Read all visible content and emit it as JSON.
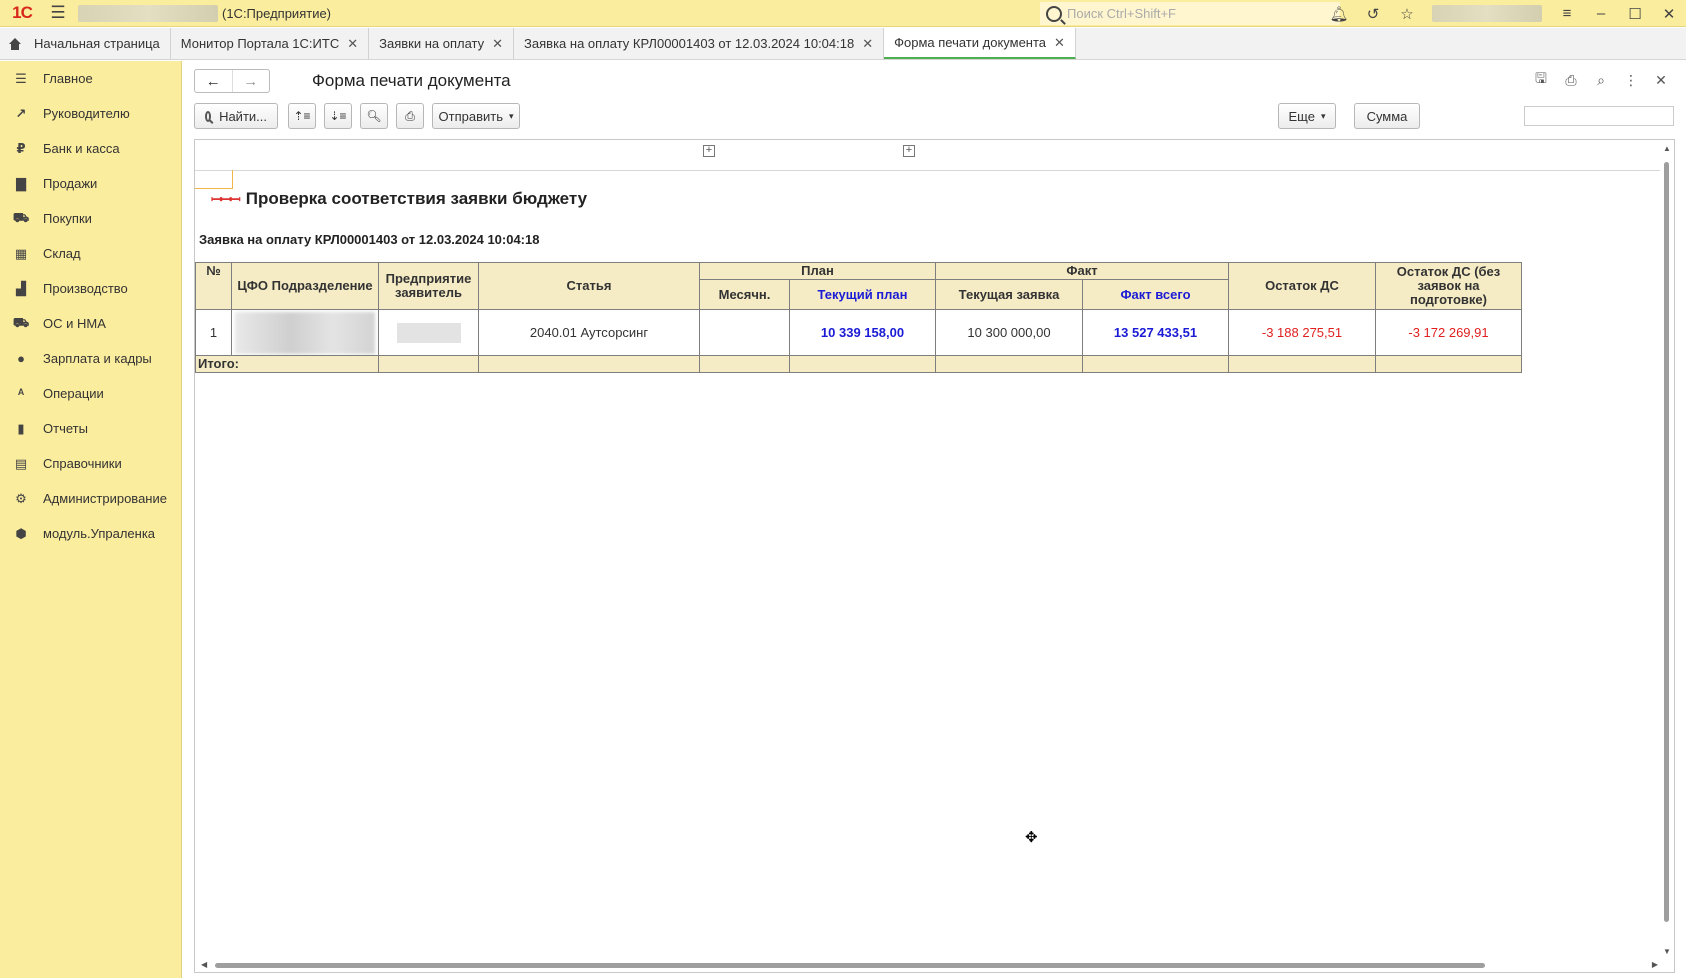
{
  "titlebar": {
    "app_name": "(1С:Предприятие)",
    "search_placeholder": "Поиск Ctrl+Shift+F",
    "logo": "1С"
  },
  "tabs": [
    {
      "label": "Начальная страница"
    },
    {
      "label": "Монитор Портала 1С:ИТС"
    },
    {
      "label": "Заявки на оплату"
    },
    {
      "label": "Заявка на оплату КРЛ00001403 от 12.03.2024 10:04:18"
    },
    {
      "label": "Форма печати документа"
    }
  ],
  "sidebar": {
    "items": [
      {
        "label": "Главное",
        "icon": "menu-icon"
      },
      {
        "label": "Руководителю",
        "icon": "trend-icon"
      },
      {
        "label": "Банк и касса",
        "icon": "ruble-icon"
      },
      {
        "label": "Продажи",
        "icon": "bag-icon"
      },
      {
        "label": "Покупки",
        "icon": "cart-icon"
      },
      {
        "label": "Склад",
        "icon": "grid-icon"
      },
      {
        "label": "Производство",
        "icon": "factory-icon"
      },
      {
        "label": "ОС и НМА",
        "icon": "truck-icon"
      },
      {
        "label": "Зарплата и кадры",
        "icon": "person-icon"
      },
      {
        "label": "Операции",
        "icon": "operations-icon"
      },
      {
        "label": "Отчеты",
        "icon": "bar-chart-icon"
      },
      {
        "label": "Справочники",
        "icon": "book-icon"
      },
      {
        "label": "Администрирование",
        "icon": "gear-icon"
      },
      {
        "label": "модуль.Упраленка",
        "icon": "cube-icon"
      }
    ]
  },
  "form": {
    "title": "Форма печати документа"
  },
  "toolbar": {
    "find_label": "Найти...",
    "send_label": "Отправить",
    "more_label": "Еще",
    "sum_label": "Сумма"
  },
  "report": {
    "title": "Проверка соответствия заявки бюджету",
    "subtitle": "Заявка на оплату КРЛ00001403 от 12.03.2024 10:04:18",
    "headers": {
      "num": "№",
      "cfo": "ЦФО Подразделение",
      "enterprise": "Предприятие заявитель",
      "article": "Статья",
      "plan": "План",
      "monthly": "Месячн.",
      "current_plan": "Текущий план",
      "fact": "Факт",
      "current_request": "Текущая заявка",
      "fact_total": "Факт всего",
      "balance": "Остаток ДС",
      "balance_no_prep": "Остаток ДС (без заявок на подготовке)"
    },
    "rows": [
      {
        "num": "1",
        "article": "2040.01   Аутсорсинг",
        "monthly": "",
        "current_plan": "10 339 158,00",
        "current_request": "10 300 000,00",
        "fact_total": "13 527 433,51",
        "balance": "-3 188 275,51",
        "balance_no_prep": "-3 172 269,91"
      }
    ],
    "total_label": "Итого:"
  },
  "colors": {
    "sidebar_bg": "#fbed9e",
    "header_cell_bg": "#f5ecc6",
    "link_blue": "#1b1bd6",
    "negative_red": "#e01f1f",
    "active_tab": "#4caf50"
  }
}
